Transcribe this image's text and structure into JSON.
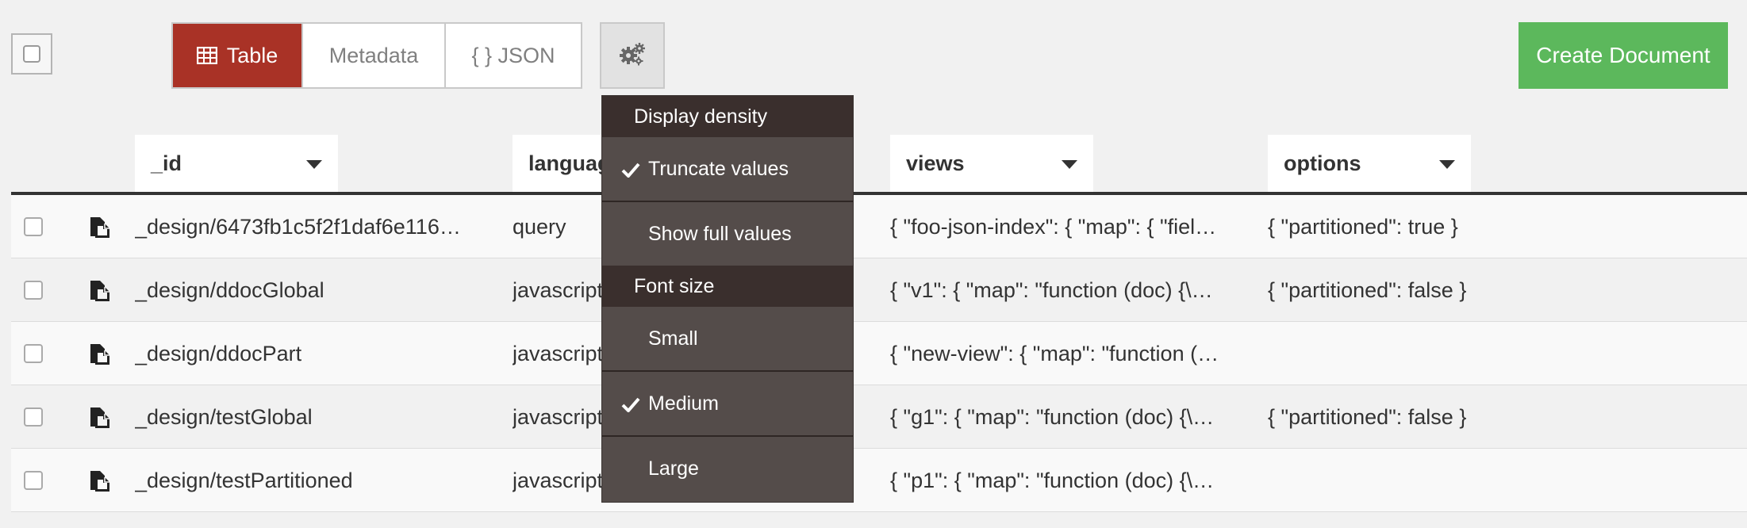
{
  "toolbar": {
    "views": [
      {
        "label": "Table",
        "active": true,
        "icon": "table-icon"
      },
      {
        "label": "Metadata",
        "active": false
      },
      {
        "label": "{ } JSON",
        "active": false
      }
    ],
    "settings_icon": "gears-icon",
    "create_label": "Create Document"
  },
  "columns": [
    {
      "label": "_id"
    },
    {
      "label": "language"
    },
    {
      "label": "views"
    },
    {
      "label": "options"
    }
  ],
  "rows": [
    {
      "id": "_design/6473fb1c5f2f1daf6e116…",
      "language": "query",
      "views": "{ \"foo-json-index\": { \"map\": { \"fiel…",
      "options": "{ \"partitioned\": true }"
    },
    {
      "id": "_design/ddocGlobal",
      "language": "javascript",
      "views": "{ \"v1\": { \"map\": \"function (doc) {\\…",
      "options": "{ \"partitioned\": false }"
    },
    {
      "id": "_design/ddocPart",
      "language": "javascript",
      "views": "{ \"new-view\": { \"map\": \"function (…",
      "options": ""
    },
    {
      "id": "_design/testGlobal",
      "language": "javascript",
      "views": "{ \"g1\": { \"map\": \"function (doc) {\\…",
      "options": "{ \"partitioned\": false }"
    },
    {
      "id": "_design/testPartitioned",
      "language": "javascript",
      "views": "{ \"p1\": { \"map\": \"function (doc) {\\…",
      "options": ""
    }
  ],
  "menu": {
    "density_header": "Display density",
    "density_options": [
      {
        "label": "Truncate values",
        "checked": true
      },
      {
        "label": "Show full values",
        "checked": false
      }
    ],
    "font_header": "Font size",
    "font_options": [
      {
        "label": "Small",
        "checked": false
      },
      {
        "label": "Medium",
        "checked": true
      },
      {
        "label": "Large",
        "checked": false
      }
    ]
  },
  "colors": {
    "active_tab": "#a93226",
    "create_button": "#5cb85c",
    "menu_bg": "#544c4a",
    "menu_header_bg": "#3a2f2d"
  }
}
